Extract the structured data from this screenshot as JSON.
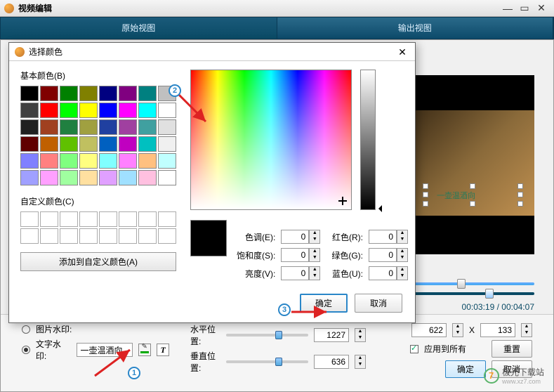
{
  "window": {
    "title": "视频编辑"
  },
  "tabs": {
    "left": "原始视图",
    "right": "输出视图"
  },
  "color_dialog": {
    "title": "选择颜色",
    "basic_label": "基本颜色(B)",
    "custom_label": "自定义颜色(C)",
    "add_custom": "添加到自定义颜色(A)",
    "hue_label": "色调(E):",
    "sat_label": "饱和度(S):",
    "val_label": "亮度(V):",
    "red_label": "红色(R):",
    "green_label": "绿色(G):",
    "blue_label": "蓝色(U):",
    "hue": "0",
    "sat": "0",
    "val": "0",
    "red": "0",
    "green": "0",
    "blue": "0",
    "ok": "确定",
    "cancel": "取消",
    "basic_colors": [
      "#000000",
      "#800000",
      "#008000",
      "#808000",
      "#000080",
      "#800080",
      "#008080",
      "#c0c0c0",
      "#404040",
      "#ff0000",
      "#00ff00",
      "#ffff00",
      "#0000ff",
      "#ff00ff",
      "#00ffff",
      "#ffffff",
      "#202020",
      "#a04020",
      "#208040",
      "#a0a040",
      "#2040a0",
      "#a040a0",
      "#40a0a0",
      "#e0e0e0",
      "#600000",
      "#c06000",
      "#60c000",
      "#c0c060",
      "#0060c0",
      "#c000c0",
      "#00c0c0",
      "#f0f0f0",
      "#8080ff",
      "#ff8080",
      "#80ff80",
      "#ffff80",
      "#80ffff",
      "#ff80ff",
      "#ffc080",
      "#c0ffff",
      "#a0a0ff",
      "#ffa0ff",
      "#a0ffa0",
      "#ffe0a0",
      "#e0a0ff",
      "#a0e0ff",
      "#ffc0e0",
      "#ffffff"
    ]
  },
  "timeline": {
    "current": "00:03:19",
    "total": "00:04:07"
  },
  "controls": {
    "image_wm_label": "图片水印:",
    "text_wm_label": "文字水印:",
    "text_wm_value": "一壶温酒向",
    "hpos_label": "水平位置:",
    "vpos_label": "垂直位置:",
    "hpos_value": "1227",
    "vpos_value": "636",
    "size_value_w": "622",
    "size_value_h": "133",
    "size_x": "X",
    "apply_all": "应用到所有",
    "reset": "重置",
    "ok": "确定",
    "cancel": "取消"
  },
  "overlay_text": "一壶温酒向",
  "annotations": {
    "a1": "1",
    "a2": "2",
    "a3": "3"
  },
  "site": {
    "name": "极光下载站",
    "url": "www.xz7.com"
  }
}
